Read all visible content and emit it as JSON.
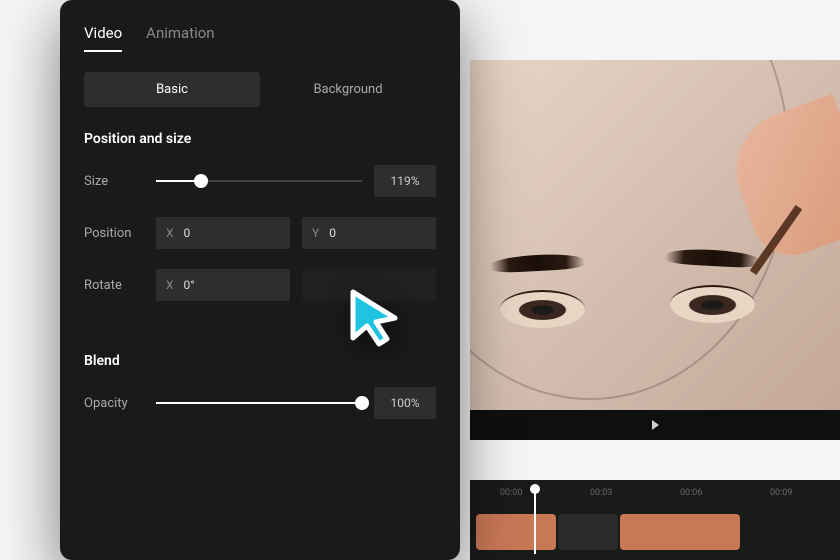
{
  "tabs": {
    "video": "Video",
    "animation": "Animation"
  },
  "subtabs": {
    "basic": "Basic",
    "background": "Background"
  },
  "sections": {
    "position_size": {
      "title": "Position and size",
      "size": {
        "label": "Size",
        "value": "119%",
        "slider_pct": 22
      },
      "position": {
        "label": "Position",
        "x_prefix": "X",
        "x_value": "0",
        "y_prefix": "Y",
        "y_value": "0"
      },
      "rotate": {
        "label": "Rotate",
        "x_prefix": "X",
        "x_value": "0°"
      }
    },
    "blend": {
      "title": "Blend",
      "opacity": {
        "label": "Opacity",
        "value": "100%",
        "slider_pct": 100
      }
    }
  },
  "timeline": {
    "marks": [
      "00:00",
      "00:03",
      "00:06",
      "00:09"
    ]
  },
  "colors": {
    "cursor": "#1fc4e0"
  }
}
